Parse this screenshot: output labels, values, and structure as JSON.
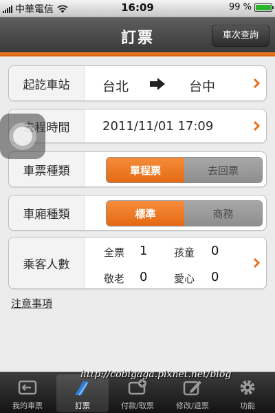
{
  "status_bar": {
    "carrier": "中華電信",
    "time": "16:09",
    "battery_text": "99 %",
    "battery_level": 0.99
  },
  "header": {
    "title": "訂票",
    "query_button": "車次查詢"
  },
  "route": {
    "label": "起訖車站",
    "from": "台北",
    "to": "台中"
  },
  "departure": {
    "label": "去程時間",
    "value": "2011/11/01 17:09"
  },
  "ticket_type": {
    "label": "車票種類",
    "options": [
      "單程票",
      "去回票"
    ],
    "selected": "單程票"
  },
  "car_class": {
    "label": "車廂種類",
    "options": [
      "標準",
      "商務"
    ],
    "selected": "標準"
  },
  "passengers": {
    "label": "乘客人數",
    "adult_label": "全票",
    "adult_count": "1",
    "child_label": "孩童",
    "child_count": "0",
    "senior_label": "敬老",
    "senior_count": "0",
    "disabled_label": "愛心",
    "disabled_count": "0"
  },
  "notes_link": "注意事項",
  "tabs": [
    {
      "label": "我的車票",
      "icon": "ticket-icon"
    },
    {
      "label": "訂票",
      "icon": "train-icon"
    },
    {
      "label": "付款/取票",
      "icon": "payment-icon"
    },
    {
      "label": "修改/退票",
      "icon": "edit-icon"
    },
    {
      "label": "功能",
      "icon": "gear-icon"
    }
  ],
  "watermark": "http://cobigaga.pixnet.net/blog",
  "colors": {
    "accent": "#e8701c",
    "nav_bg": "#4a4a4a",
    "tab_bg": "#1e1e1e"
  }
}
